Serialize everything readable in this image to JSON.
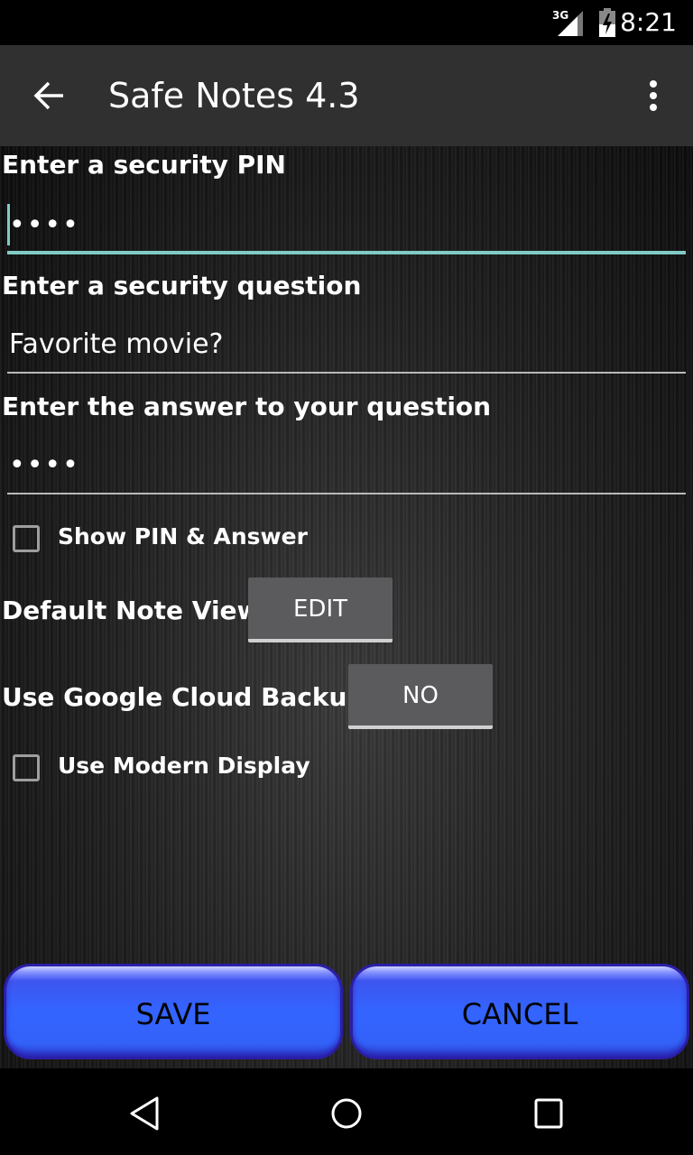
{
  "status_bar": {
    "network": "3G",
    "time": "8:21",
    "icons": [
      "signal-icon",
      "battery-charging-icon"
    ]
  },
  "app_bar": {
    "title": "Safe Notes 4.3",
    "back_icon": "arrow-back-icon",
    "menu_icon": "overflow-menu-icon"
  },
  "form": {
    "pin": {
      "label": "Enter a security PIN",
      "value": "••••"
    },
    "question": {
      "label": "Enter a security question",
      "value": "Favorite movie?"
    },
    "answer": {
      "label": "Enter the answer to your question",
      "value": "••••"
    },
    "show_pin": {
      "label": "Show PIN & Answer",
      "checked": false
    },
    "default_view": {
      "label": "Default Note View:",
      "value": "EDIT"
    },
    "cloud_backup": {
      "label": "Use Google Cloud Backup:",
      "value": "NO"
    },
    "modern_display": {
      "label": "Use Modern Display",
      "checked": false
    }
  },
  "actions": {
    "save": "SAVE",
    "cancel": "CANCEL"
  },
  "nav_bar": {
    "icons": [
      "back-icon",
      "home-icon",
      "recents-icon"
    ]
  }
}
